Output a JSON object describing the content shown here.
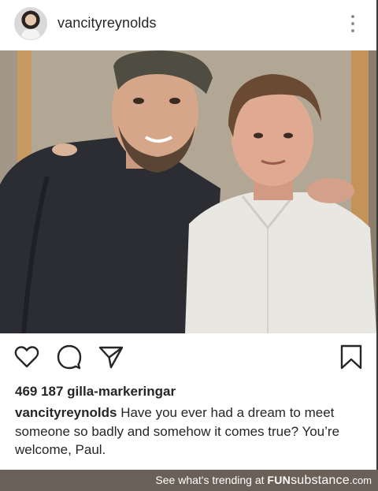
{
  "post": {
    "username": "vancityreynolds",
    "likes_text": "469 187 gilla-markeringar",
    "caption_user": "vancityreynolds",
    "caption_text": "Have you ever had a dream to meet someone so badly and somehow it comes true? You’re welcome, Paul."
  },
  "icons": {
    "more": "more-vertical-icon",
    "like": "heart-icon",
    "comment": "comment-icon",
    "share": "send-icon",
    "save": "bookmark-icon"
  },
  "footer": {
    "prefix": "See what's trending at",
    "brand_fun": "FUN",
    "brand_substance": "substance",
    "brand_domain": ".com"
  },
  "colors": {
    "text": "#262626",
    "footer_bg": "#6a6058",
    "icon_gray": "#8e8e8e"
  }
}
